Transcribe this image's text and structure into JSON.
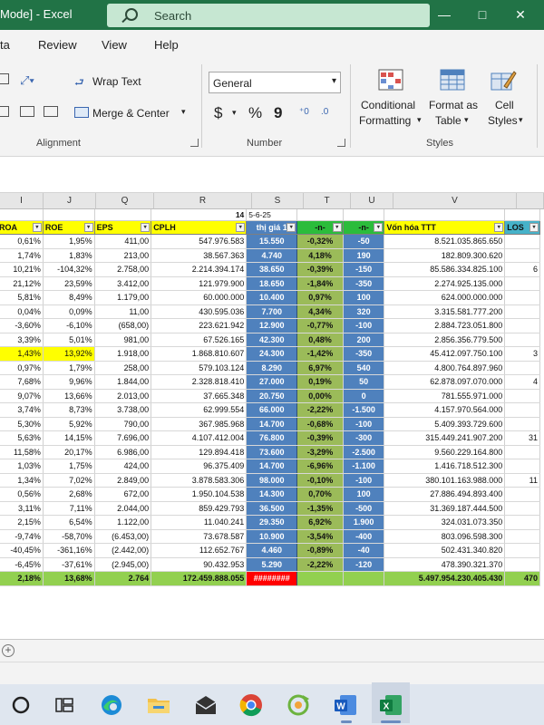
{
  "titlebar": {
    "title": "Mode]  -  Excel",
    "search_placeholder": "Search",
    "minimize": "—",
    "maximize": "□",
    "close": "✕"
  },
  "menu": [
    "ta",
    "Review",
    "View",
    "Help"
  ],
  "ribbon": {
    "wrap_text": "Wrap Text",
    "merge_center": "Merge & Center",
    "alignment_label": "Alignment",
    "number_format": "General",
    "currency": "$",
    "percent": "%",
    "comma": "9",
    "number_label": "Number",
    "conditional_formatting": [
      "Conditional",
      "Formatting"
    ],
    "format_as_table": [
      "Format as",
      "Table"
    ],
    "cell_styles": [
      "Cell",
      "Styles"
    ],
    "styles_label": "Styles"
  },
  "columns": [
    "I",
    "J",
    "Q",
    "R",
    "S",
    "T",
    "U",
    "V",
    ""
  ],
  "sheet": {
    "top_row": {
      "s_num": "14",
      "s_date": "5-6-25"
    },
    "headers": [
      "ROA",
      "ROE",
      "EPS",
      "CPLH",
      "thị giá 1",
      "-n-",
      "-n-",
      "Vốn hóa TTT",
      "LOS"
    ],
    "rows": [
      [
        "0,61%",
        "1,95%",
        "411,00",
        "547.976.583",
        "15.550",
        "-0,32%",
        "-50",
        "8.521.035.865.650",
        ""
      ],
      [
        "1,74%",
        "1,83%",
        "213,00",
        "38.567.363",
        "4.740",
        "4,18%",
        "190",
        "182.809.300.620",
        ""
      ],
      [
        "10,21%",
        "-104,32%",
        "2.758,00",
        "2.214.394.174",
        "38.650",
        "-0,39%",
        "-150",
        "85.586.334.825.100",
        "6"
      ],
      [
        "21,12%",
        "23,59%",
        "3.412,00",
        "121.979.900",
        "18.650",
        "-1,84%",
        "-350",
        "2.274.925.135.000",
        ""
      ],
      [
        "5,81%",
        "8,49%",
        "1.179,00",
        "60.000.000",
        "10.400",
        "0,97%",
        "100",
        "624.000.000.000",
        ""
      ],
      [
        "0,04%",
        "0,09%",
        "11,00",
        "430.595.036",
        "7.700",
        "4,34%",
        "320",
        "3.315.581.777.200",
        ""
      ],
      [
        "-3,60%",
        "-6,10%",
        "(658,00)",
        "223.621.942",
        "12.900",
        "-0,77%",
        "-100",
        "2.884.723.051.800",
        ""
      ],
      [
        "3,39%",
        "5,01%",
        "981,00",
        "67.526.165",
        "42.300",
        "0,48%",
        "200",
        "2.856.356.779.500",
        ""
      ],
      [
        "1,43%",
        "13,92%",
        "1.918,00",
        "1.868.810.607",
        "24.300",
        "-1,42%",
        "-350",
        "45.412.097.750.100",
        "3"
      ],
      [
        "0,97%",
        "1,79%",
        "258,00",
        "579.103.124",
        "8.290",
        "6,97%",
        "540",
        "4.800.764.897.960",
        ""
      ],
      [
        "7,68%",
        "9,96%",
        "1.844,00",
        "2.328.818.410",
        "27.000",
        "0,19%",
        "50",
        "62.878.097.070.000",
        "4"
      ],
      [
        "9,07%",
        "13,66%",
        "2.013,00",
        "37.665.348",
        "20.750",
        "0,00%",
        "0",
        "781.555.971.000",
        ""
      ],
      [
        "3,74%",
        "8,73%",
        "3.738,00",
        "62.999.554",
        "66.000",
        "-2,22%",
        "-1.500",
        "4.157.970.564.000",
        ""
      ],
      [
        "5,30%",
        "5,92%",
        "790,00",
        "367.985.968",
        "14.700",
        "-0,68%",
        "-100",
        "5.409.393.729.600",
        ""
      ],
      [
        "5,63%",
        "14,15%",
        "7.696,00",
        "4.107.412.004",
        "76.800",
        "-0,39%",
        "-300",
        "315.449.241.907.200",
        "31"
      ],
      [
        "11,58%",
        "20,17%",
        "6.986,00",
        "129.894.418",
        "73.600",
        "-3,29%",
        "-2.500",
        "9.560.229.164.800",
        ""
      ],
      [
        "1,03%",
        "1,75%",
        "424,00",
        "96.375.409",
        "14.700",
        "-6,96%",
        "-1.100",
        "1.416.718.512.300",
        ""
      ],
      [
        "1,34%",
        "7,02%",
        "2.849,00",
        "3.878.583.306",
        "98.000",
        "-0,10%",
        "-100",
        "380.101.163.988.000",
        "11"
      ],
      [
        "0,56%",
        "2,68%",
        "672,00",
        "1.950.104.538",
        "14.300",
        "0,70%",
        "100",
        "27.886.494.893.400",
        ""
      ],
      [
        "3,11%",
        "7,11%",
        "2.044,00",
        "859.429.793",
        "36.500",
        "-1,35%",
        "-500",
        "31.369.187.444.500",
        ""
      ],
      [
        "2,15%",
        "6,54%",
        "1.122,00",
        "11.040.241",
        "29.350",
        "6,92%",
        "1.900",
        "324.031.073.350",
        ""
      ],
      [
        "-9,74%",
        "-58,70%",
        "(6.453,00)",
        "73.678.587",
        "10.900",
        "-3,54%",
        "-400",
        "803.096.598.300",
        ""
      ],
      [
        "-40,45%",
        "-361,16%",
        "(2.442,00)",
        "112.652.767",
        "4.460",
        "-0,89%",
        "-40",
        "502.431.340.820",
        ""
      ],
      [
        "-6,45%",
        "-37,61%",
        "(2.945,00)",
        "90.432.953",
        "5.290",
        "-2,22%",
        "-120",
        "478.390.321.370",
        ""
      ]
    ],
    "sum_row": [
      "2,18%",
      "13,68%",
      "2.764",
      "172.459.888.055",
      "########",
      "",
      "",
      "5.497.954.230.405.430",
      "470"
    ]
  },
  "colors": {
    "excel_green": "#217346",
    "header_yellow": "#ffff00",
    "price_blue": "#4f81bd",
    "change_green": "#9bbb59",
    "sum_green": "#92d050",
    "error_red": "#ff0000"
  },
  "taskbar": [
    "cortana-icon",
    "task-view-icon",
    "edge-icon",
    "file-explorer-icon",
    "mail-icon",
    "chrome-icon",
    "app-icon",
    "word-icon",
    "excel-icon"
  ]
}
